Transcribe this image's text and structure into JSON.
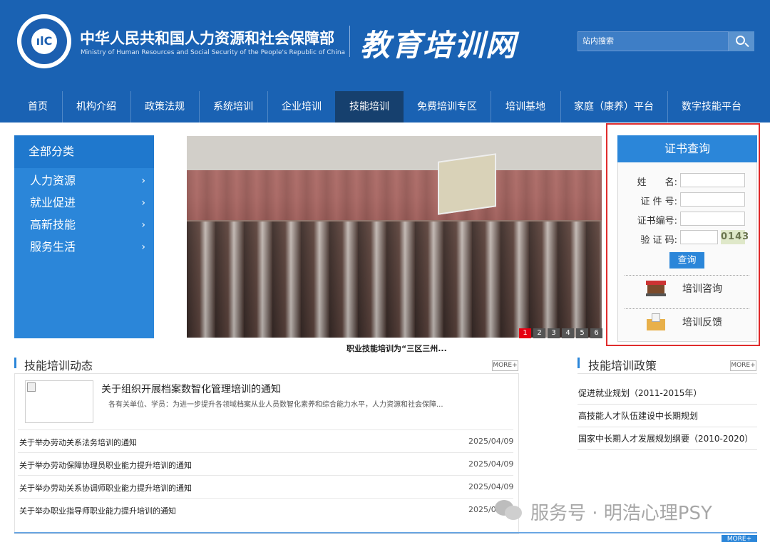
{
  "header": {
    "org_cn": "中华人民共和国人力资源和社会保障部",
    "org_en": "Ministry of Human Resources and Social Security of the People's Republic of China",
    "site_title": "教育培训网",
    "search_placeholder": "站内搜索"
  },
  "nav": [
    {
      "label": "首页"
    },
    {
      "label": "机构介绍"
    },
    {
      "label": "政策法规"
    },
    {
      "label": "系统培训"
    },
    {
      "label": "企业培训"
    },
    {
      "label": "技能培训",
      "active": true
    },
    {
      "label": "免费培训专区"
    },
    {
      "label": "培训基地"
    },
    {
      "label": "家庭（康养）平台"
    },
    {
      "label": "数字技能平台"
    }
  ],
  "categories": {
    "title": "全部分类",
    "items": [
      {
        "label": "人力资源",
        "arrow": "›"
      },
      {
        "label": "就业促进",
        "arrow": "›"
      },
      {
        "label": "高新技能",
        "arrow": "›"
      },
      {
        "label": "服务生活",
        "arrow": "›"
      }
    ]
  },
  "carousel": {
    "caption": "职业技能培训为“三区三州...",
    "pages": [
      "1",
      "2",
      "3",
      "4",
      "5",
      "6"
    ],
    "active_page": "1"
  },
  "cert_query": {
    "title": "证书查询",
    "fields": [
      {
        "label": "姓　　名:"
      },
      {
        "label": "证 件 号:"
      },
      {
        "label": "证书编号:"
      },
      {
        "label": "验 证 码:"
      }
    ],
    "captcha": "0143",
    "button": "查询",
    "links": [
      {
        "label": "培训咨询",
        "icon": "consult-icon"
      },
      {
        "label": "培训反馈",
        "icon": "feedback-icon"
      }
    ]
  },
  "news": {
    "title": "技能培训动态",
    "more": "MORE+",
    "feature": {
      "title": "关于组织开展档案数智化管理培训的通知",
      "summary": "各有关单位、学员：为进一步提升各领域档案从业人员数智化素养和综合能力水平，人力资源和社会保障..."
    },
    "items": [
      {
        "title": "关于举办劳动关系法务培训的通知",
        "date": "2025/04/09"
      },
      {
        "title": "关于举办劳动保障协理员职业能力提升培训的通知",
        "date": "2025/04/09"
      },
      {
        "title": "关于举办劳动关系协调师职业能力提升培训的通知",
        "date": "2025/04/09"
      },
      {
        "title": "关于举办职业指导师职业能力提升培训的通知",
        "date": "2025/04/09"
      }
    ]
  },
  "policy": {
    "title": "技能培训政策",
    "more": "MORE+",
    "items": [
      {
        "title": "促进就业规划（2011-2015年）"
      },
      {
        "title": "高技能人才队伍建设中长期规划"
      },
      {
        "title": "国家中长期人才发展规划纲要（2010-2020）"
      }
    ]
  },
  "footer": {
    "more": "MORE+"
  },
  "watermark": {
    "text": "服务号 · 明浩心理PSY"
  },
  "colors": {
    "header_blue": "#1a62b3",
    "nav_active": "#16406e",
    "accent_blue": "#2b86d9",
    "highlight_red": "#e02c2c",
    "carousel_active": "#e60012"
  }
}
